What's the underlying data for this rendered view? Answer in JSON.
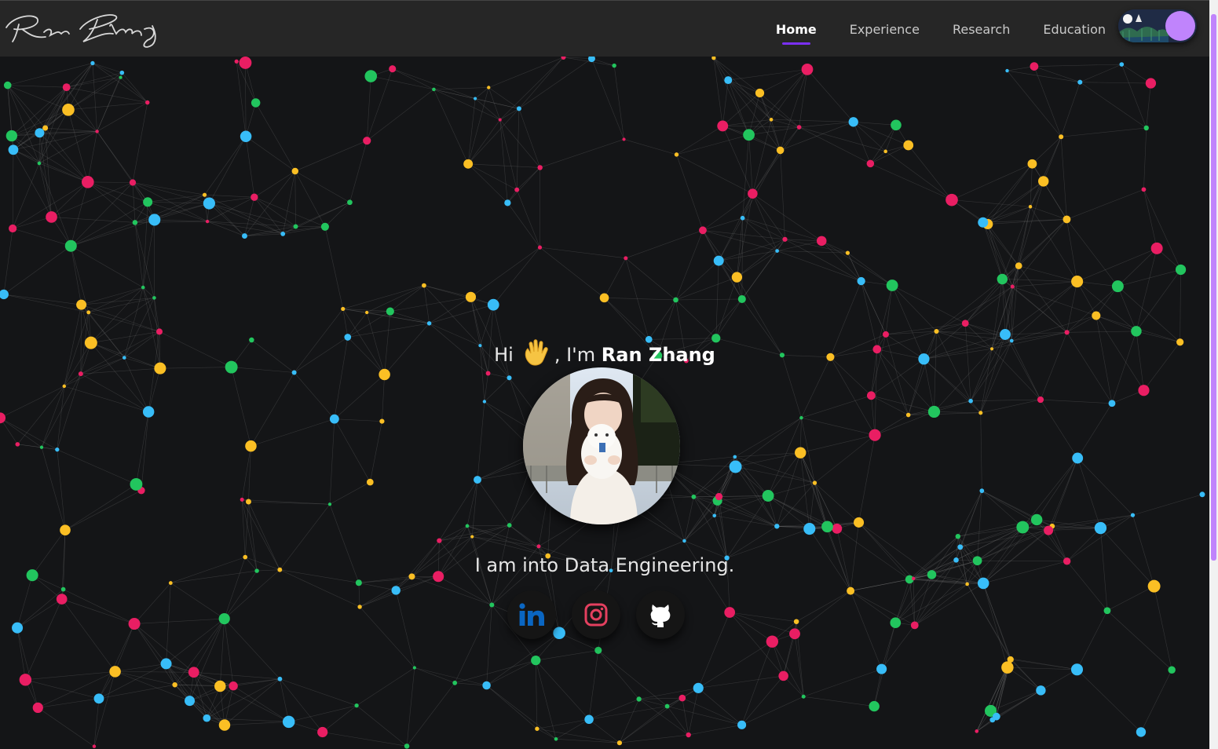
{
  "logo": {
    "text": "Ran Zhang"
  },
  "nav": {
    "links": [
      {
        "label": "Home",
        "active": true
      },
      {
        "label": "Experience",
        "active": false
      },
      {
        "label": "Research",
        "active": false
      },
      {
        "label": "Education",
        "active": false
      }
    ],
    "theme_toggle": {
      "state": "dark"
    }
  },
  "hero": {
    "greeting_prefix": "Hi",
    "greeting_middle": ", I'm",
    "name": "Ran Zhang",
    "tagline": "I am into Data Engineering."
  },
  "socials": [
    {
      "name": "LinkedIn",
      "icon": "linkedin-icon",
      "color": "#0a66c2"
    },
    {
      "name": "Instagram",
      "icon": "instagram-icon",
      "color": "#e4405f"
    },
    {
      "name": "GitHub",
      "icon": "github-icon",
      "color": "#ffffff"
    }
  ],
  "colors": {
    "background": "#141517",
    "navbar": "#262626",
    "accent": "#7b2ff7",
    "toggle_knob": "#c084fc",
    "particles": [
      "#e91e63",
      "#fbbf24",
      "#22c55e",
      "#38bdf8"
    ]
  }
}
